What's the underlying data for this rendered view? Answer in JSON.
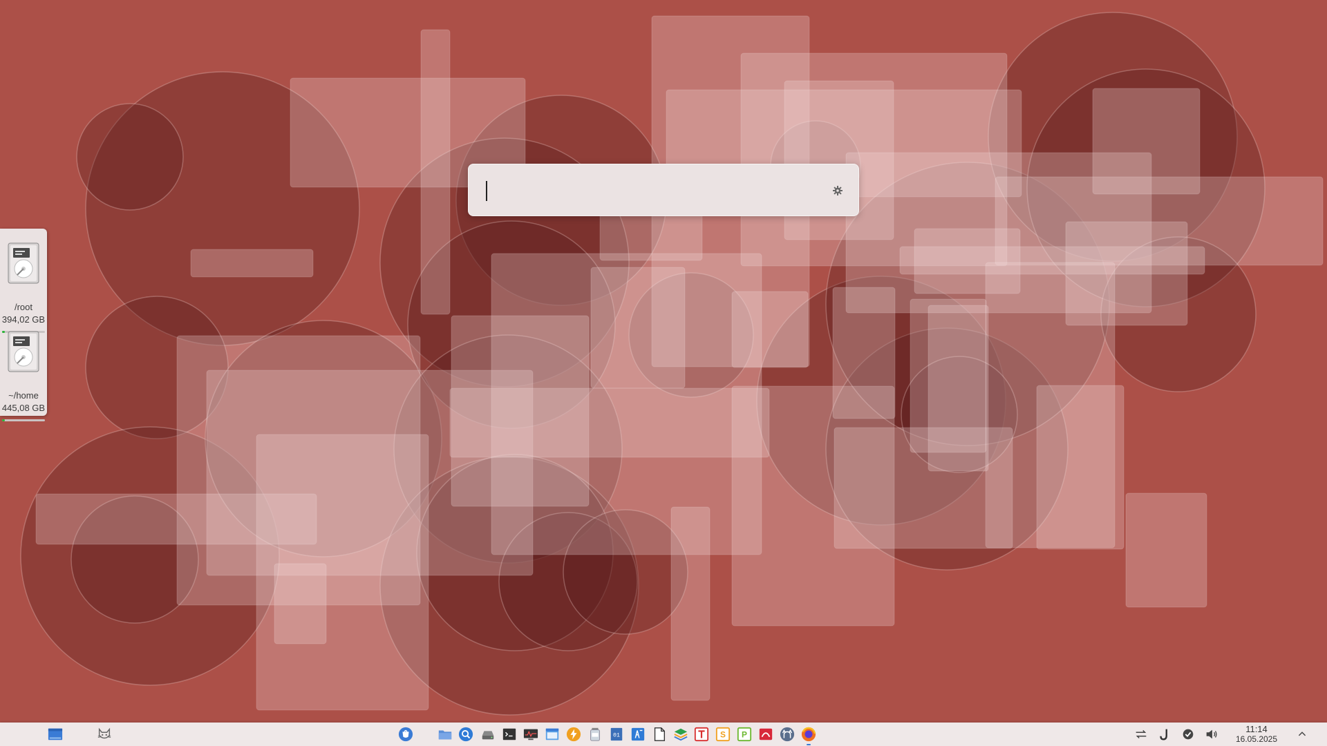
{
  "krunner": {
    "input_value": "",
    "settings_icon": "gear-icon"
  },
  "disks": [
    {
      "path": "/root",
      "size": "394,02 GB",
      "used_fraction": 0.06,
      "icon": "hard-drive-icon"
    },
    {
      "path": "~/home",
      "size": "445,08 GB",
      "used_fraction": 0.06,
      "icon": "hard-drive-icon"
    }
  ],
  "taskbar": {
    "left": [
      {
        "icon": "desktop-pager-icon"
      },
      {
        "icon": "cat-face-icon"
      }
    ],
    "launchers": [
      {
        "icon": "discover-store-icon"
      },
      {
        "icon": "folder-icon"
      },
      {
        "icon": "search-icon"
      },
      {
        "icon": "disk-drive-icon"
      },
      {
        "icon": "terminal-icon"
      },
      {
        "icon": "system-monitor-icon"
      },
      {
        "icon": "window-icon"
      },
      {
        "icon": "lightning-icon"
      },
      {
        "icon": "jar-icon"
      },
      {
        "icon": "binary-file-icon"
      },
      {
        "icon": "equation-editor-icon"
      },
      {
        "icon": "blank-document-icon"
      },
      {
        "icon": "layers-icon"
      },
      {
        "icon": "text-editor-t-icon"
      },
      {
        "icon": "spreadsheet-s-icon"
      },
      {
        "icon": "presentation-p-icon"
      },
      {
        "icon": "pdf-reader-icon"
      },
      {
        "icon": "github-icon"
      },
      {
        "icon": "firefox-icon"
      }
    ],
    "tray": [
      {
        "icon": "network-sync-icon"
      },
      {
        "icon": "magnet-icon"
      },
      {
        "icon": "checkmark-circle-icon"
      },
      {
        "icon": "speaker-icon"
      }
    ],
    "clock": {
      "time": "11:14",
      "date": "16.05.2025"
    },
    "expand_icon": "chevron-up-icon"
  },
  "colors": {
    "wallpaper_base": "#ac5048",
    "panel_bg": "#efe8e8",
    "accent": "#3a7bd5"
  }
}
